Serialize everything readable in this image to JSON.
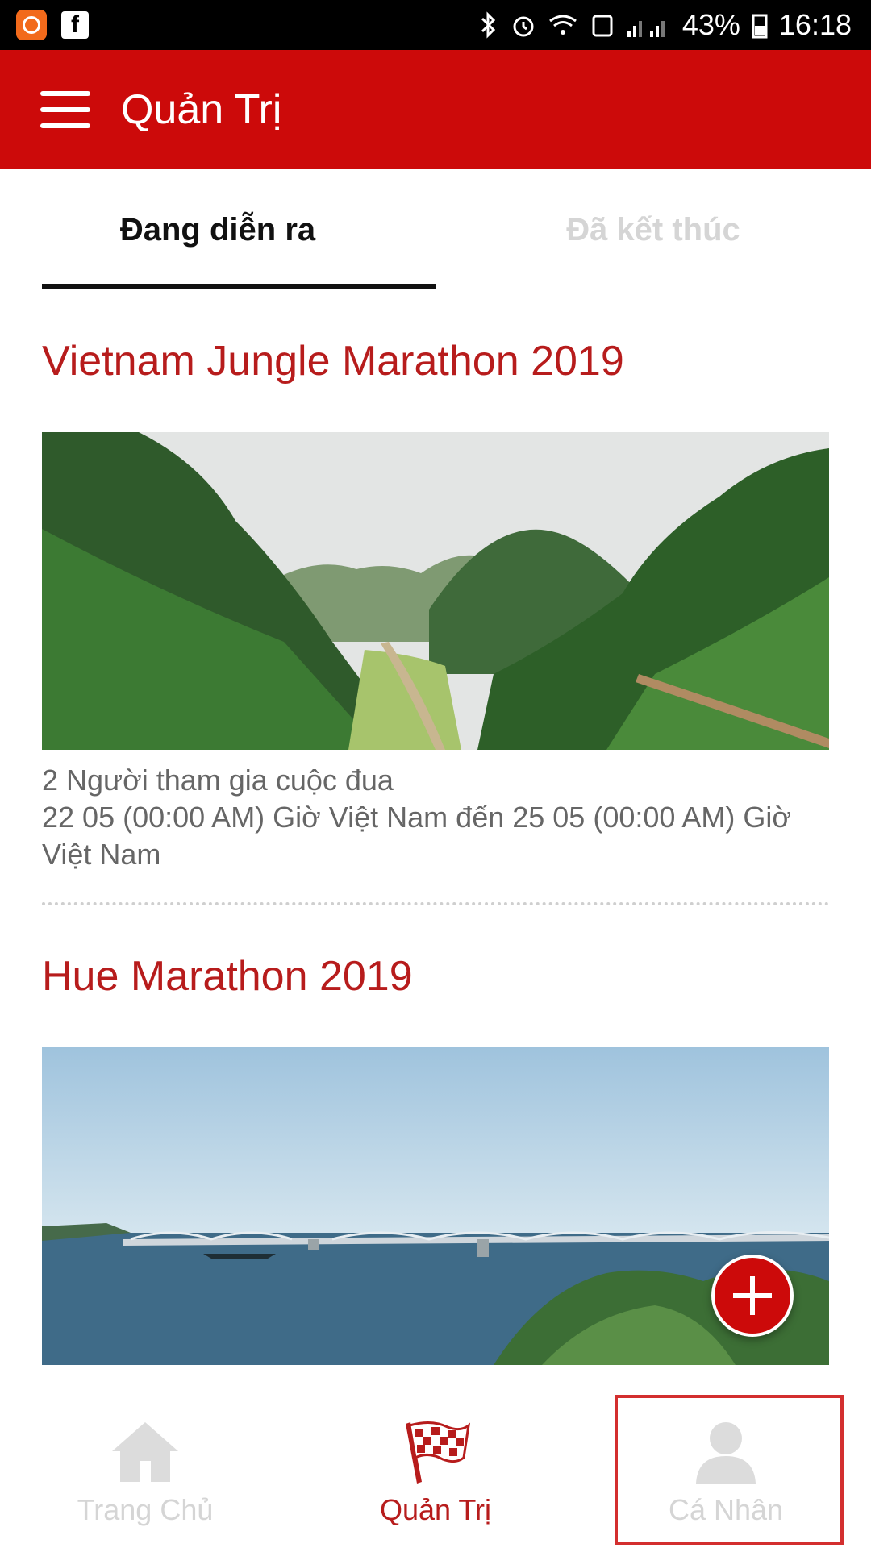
{
  "status_bar": {
    "battery": "43%",
    "time": "16:18"
  },
  "header": {
    "title": "Quản Trị"
  },
  "tabs": [
    {
      "label": "Đang diễn ra",
      "active": true
    },
    {
      "label": "Đã kết thúc",
      "active": false
    }
  ],
  "races": [
    {
      "title": "Vietnam Jungle Marathon 2019",
      "participants": "2 Người tham gia cuộc đua",
      "schedule": "22 05 (00:00 AM) Giờ Việt Nam đến 25 05 (00:00 AM) Giờ Việt Nam"
    },
    {
      "title": "Hue Marathon 2019"
    }
  ],
  "bottom_nav": [
    {
      "label": "Trang Chủ",
      "icon": "home-icon",
      "active": false
    },
    {
      "label": "Quản Trị",
      "icon": "checkered-flag-icon",
      "active": true
    },
    {
      "label": "Cá Nhân",
      "icon": "person-icon",
      "active": false
    }
  ],
  "colors": {
    "brand": "#cc0a0a",
    "title_red": "#b71c1c",
    "inactive": "#d5d5d5"
  }
}
